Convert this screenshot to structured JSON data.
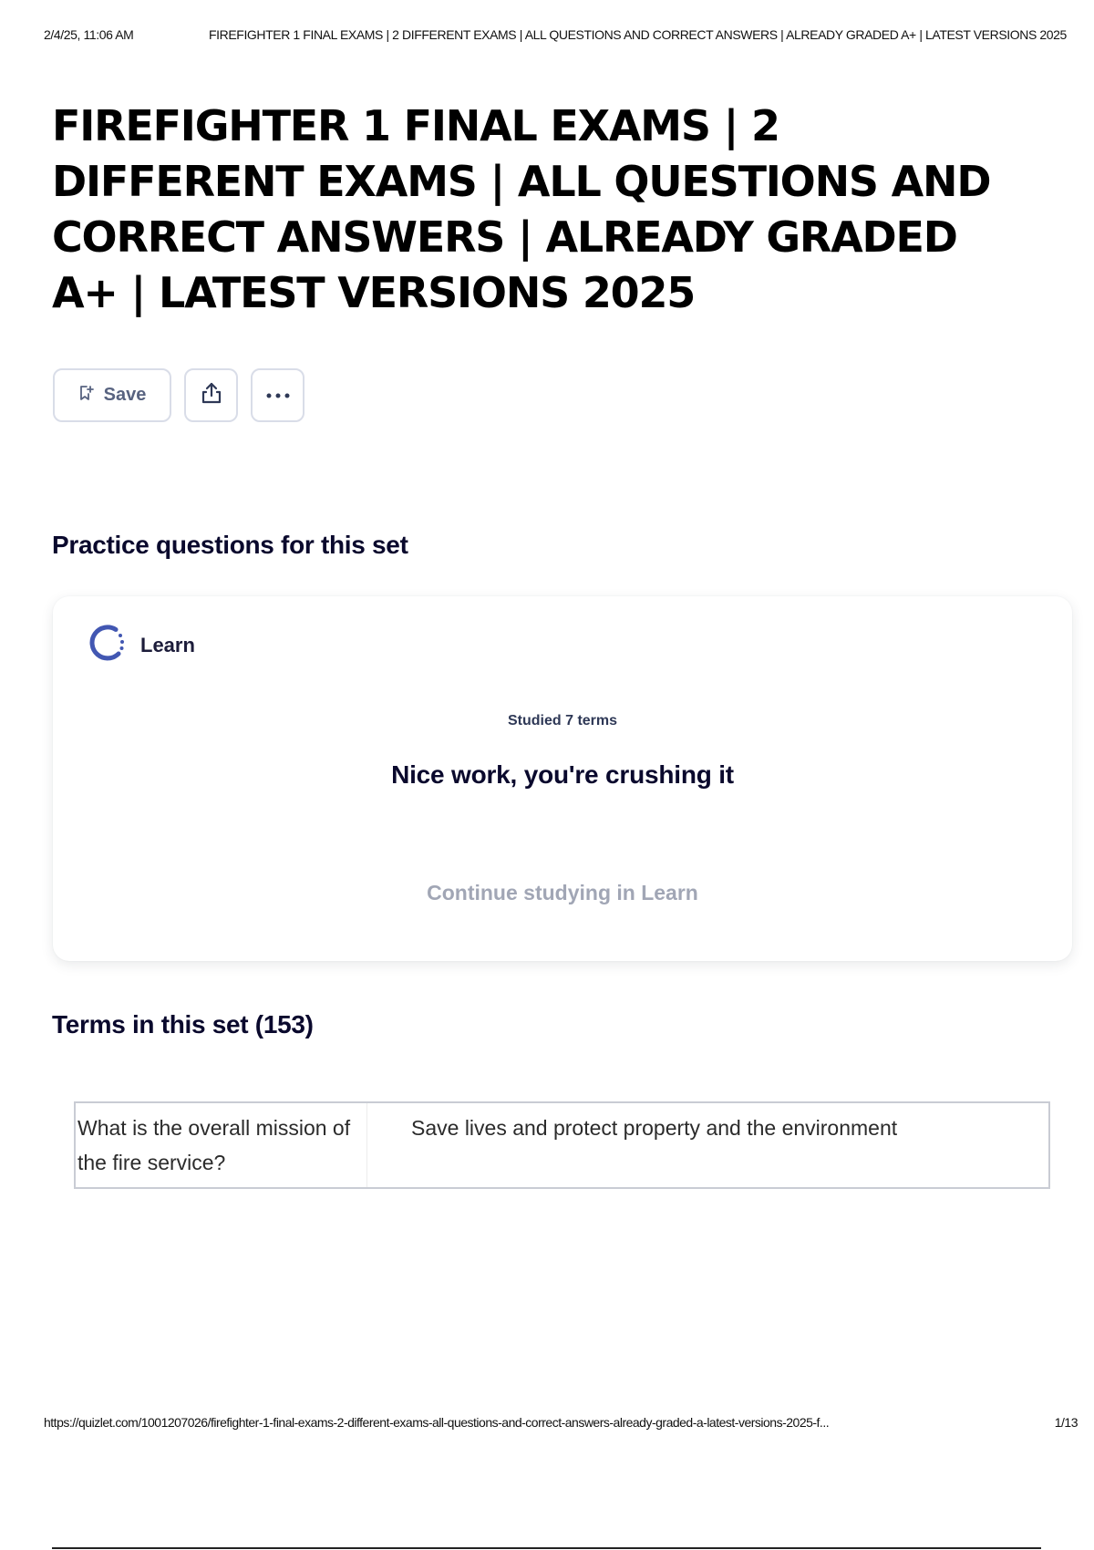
{
  "print_header": {
    "timestamp": "2/4/25, 11:06 AM",
    "title": "FIREFIGHTER 1 FINAL EXAMS | 2 DIFFERENT EXAMS | ALL QUESTIONS AND CORRECT ANSWERS | ALREADY GRADED A+ | LATEST VERSIONS 2025"
  },
  "page": {
    "title": "FIREFIGHTER 1 FINAL EXAMS | 2 DIFFERENT EXAMS | ALL QUESTIONS AND CORRECT ANSWERS | ALREADY GRADED A+ | LATEST VERSIONS 2025"
  },
  "actions": {
    "save_label": "Save",
    "save_icon": "bookmark-plus-icon",
    "share_icon": "share-icon",
    "more_icon": "more-horizontal-icon"
  },
  "practice": {
    "heading": "Practice questions for this set",
    "learn": {
      "label": "Learn",
      "icon": "learn-progress-icon",
      "studied_text": "Studied 7 terms",
      "message": "Nice work, you're crushing it",
      "continue_label": "Continue studying in Learn"
    }
  },
  "terms": {
    "heading": "Terms in this set (153)",
    "rows": [
      {
        "term": "What is the overall mission of the fire service?",
        "definition": "Save lives and protect property and the environment"
      }
    ]
  },
  "print_footer": {
    "url": "https://quizlet.com/1001207026/firefighter-1-final-exams-2-different-exams-all-questions-and-correct-answers-already-graded-a-latest-versions-2025-f...",
    "page_indicator": "1/13"
  },
  "colors": {
    "accent": "#4257b2",
    "text_dark": "#0a092d",
    "muted": "#a1a6b5",
    "border": "#d9dde8"
  }
}
